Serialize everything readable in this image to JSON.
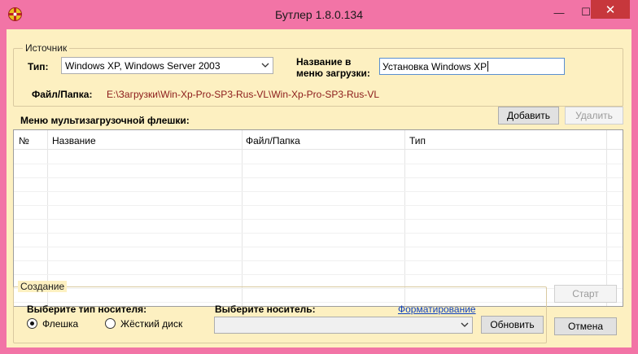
{
  "window": {
    "title": "Бутлер 1.8.0.134",
    "minimize_glyph": "—",
    "maximize_glyph": "☐",
    "close_glyph": "✕"
  },
  "source": {
    "group_label": "Источник",
    "type_label": "Тип:",
    "type_value": "Windows XP, Windows Server 2003",
    "menu_name_label_line1": "Название в",
    "menu_name_label_line2": "меню загрузки:",
    "menu_name_value": "Установка Windows XP",
    "path_label": "Файл/Папка:",
    "path_value": "E:\\Загрузки\\Win-Xp-Pro-SP3-Rus-VL\\Win-Xp-Pro-SP3-Rus-VL"
  },
  "menu": {
    "label": "Меню мультизагрузочной флешки:",
    "add_button": "Добавить",
    "delete_button": "Удалить",
    "columns": [
      "№",
      "Название",
      "Файл/Папка",
      "Тип"
    ]
  },
  "create": {
    "group_label": "Создание",
    "media_type_label": "Выберите тип носителя:",
    "media_options": [
      "Флешка",
      "Жёсткий диск"
    ],
    "selected_media": "Флешка",
    "device_label": "Выберите носитель:",
    "format_link": "Форматирование",
    "device_value": "",
    "refresh_button": "Обновить",
    "start_button": "Старт",
    "cancel_button": "Отмена"
  }
}
